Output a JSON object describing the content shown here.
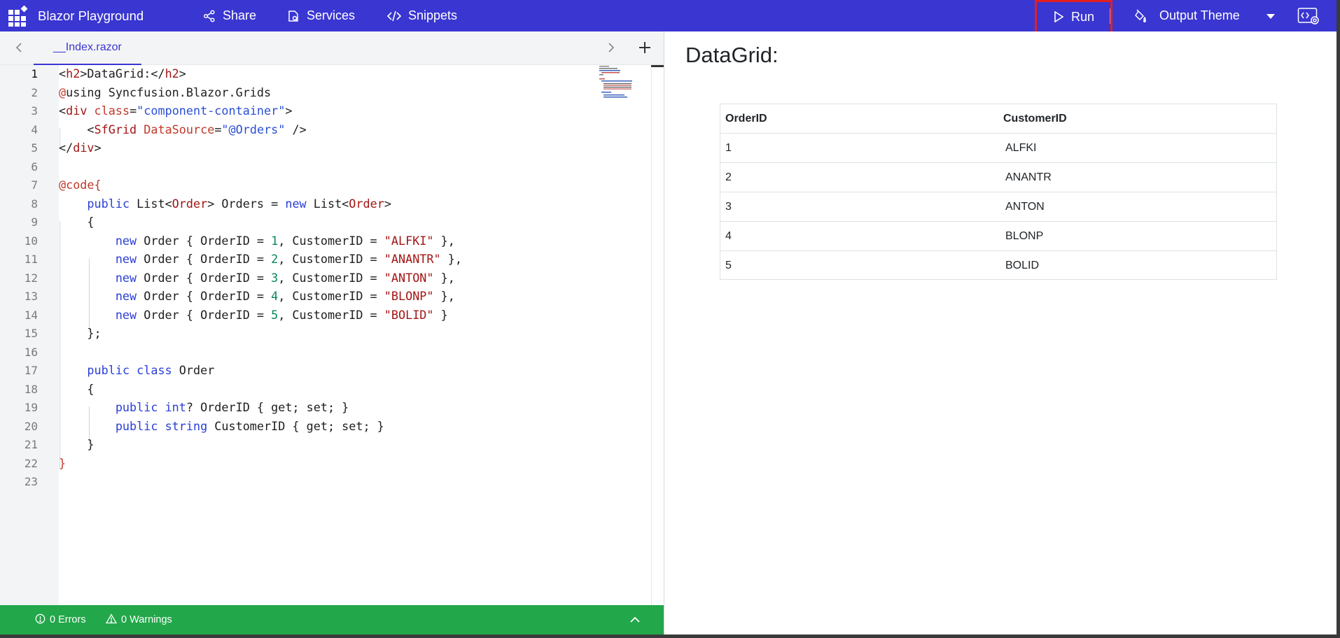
{
  "header": {
    "title": "Blazor Playground",
    "share_label": "Share",
    "services_label": "Services",
    "snippets_label": "Snippets",
    "run_label": "Run",
    "theme_label": "Output Theme"
  },
  "editor": {
    "tab_file": "__Index.razor",
    "line_numbers": [
      "1",
      "2",
      "3",
      "4",
      "5",
      "6",
      "7",
      "8",
      "9",
      "10",
      "11",
      "12",
      "13",
      "14",
      "15",
      "16",
      "17",
      "18",
      "19",
      "20",
      "21",
      "22",
      "23"
    ]
  },
  "status": {
    "errors": "0 Errors",
    "warnings": "0 Warnings"
  },
  "output": {
    "title": "DataGrid:",
    "grid": {
      "headers": [
        "OrderID",
        "CustomerID"
      ],
      "rows": [
        [
          "1",
          "ALFKI"
        ],
        [
          "2",
          "ANANTR"
        ],
        [
          "3",
          "ANTON"
        ],
        [
          "4",
          "BLONP"
        ],
        [
          "5",
          "BOLID"
        ]
      ]
    }
  },
  "colors": {
    "header_bg": "#3a36d1",
    "status_bg": "#22a74a",
    "run_highlight": "#e02020"
  },
  "icons": [
    "grid-logo-icon",
    "share-icon",
    "services-icon",
    "code-icon",
    "play-icon",
    "paint-icon",
    "caret-down-icon",
    "settings-code-icon",
    "chevron-left-icon",
    "chevron-right-icon",
    "plus-icon",
    "error-icon",
    "warning-icon",
    "chevron-up-icon"
  ]
}
